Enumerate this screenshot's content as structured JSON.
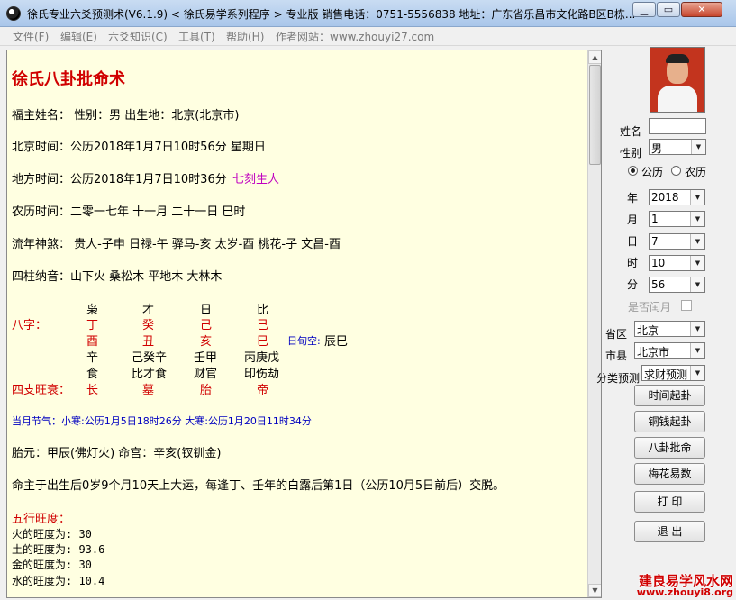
{
  "window": {
    "title": "徐氏专业六爻预测术(V6.1.9)  < 徐氏易学系列程序 > 专业版  销售电话：0751-5556838  地址：广东省乐昌市文化路B区B栋...",
    "min_glyph": "▁",
    "max_glyph": "▭",
    "close_glyph": "✕"
  },
  "menu": {
    "file": "文件(F)",
    "edit": "编辑(E)",
    "knowledge": "六爻知识(C)",
    "tools": "工具(T)",
    "help": "帮助(H)",
    "website": "作者网站：www.zhouyi27.com"
  },
  "document": {
    "heading": "徐氏八卦批命术",
    "owner_line": "福主姓名：  性别：男    出生地：北京(北京市)",
    "beijing_time": "北京时间：公历2018年1月7日10时56分  星期日",
    "local_time_label": "地方时间：公历2018年1月7日10时36分",
    "local_time_note": "七刻生人",
    "lunar_time": "农历时间：二零一七年  十一月  二十一日  巳时",
    "shensha": "流年神煞：  贵人-子申  日禄-午  驿马-亥  太岁-酉  桃花-子  文昌-酉",
    "nayin": "四柱纳音：山下火     桑松木     平地木     大林木",
    "bazi_label": "八字：",
    "shishen_top": [
      "枭",
      "才",
      "日",
      "比"
    ],
    "stems": [
      "丁",
      "癸",
      "己",
      "己"
    ],
    "branches": [
      "酉",
      "丑",
      "亥",
      "巳"
    ],
    "xunkong_label": "日旬空:",
    "xunkong_value": "辰巳",
    "canggan": [
      "辛",
      "己癸辛",
      "壬甲",
      "丙庚戊"
    ],
    "canggan_shishen": [
      "食",
      "比才食",
      "财官",
      "印伤劫"
    ],
    "wangshuai_label": "四支旺衰：",
    "wangshuai": [
      "长",
      "墓",
      "胎",
      "帝"
    ],
    "jieqi": "当月节气：小寒:公历1月5日18时26分  大寒:公历1月20日11时34分",
    "taiyuan": "胎元：甲辰(佛灯火)    命宫：辛亥(钗钏金)",
    "dayun": "命主于出生后0岁9个月10天上大运，每逢丁、壬年的白露后第1日（公历10月5日前后）交脱。",
    "wuxing_title": "五行旺度：",
    "wuxing": [
      "火的旺度为: 30",
      "土的旺度为: 93.6",
      "金的旺度为: 30",
      "水的旺度为: 10.4"
    ]
  },
  "panel": {
    "name_label": "姓名",
    "name_value": "",
    "gender_label": "性别",
    "gender_value": "男",
    "solar_label": "公历",
    "lunar_label": "农历",
    "year_label": "年",
    "year_value": "2018",
    "month_label": "月",
    "month_value": "1",
    "day_label": "日",
    "day_value": "7",
    "hour_label": "时",
    "hour_value": "10",
    "minute_label": "分",
    "minute_value": "56",
    "leap_label": "是否闰月",
    "province_label": "省区",
    "province_value": "北京",
    "city_label": "市县",
    "city_value": "北京市",
    "category_label": "分类预测",
    "category_value": "求财预测",
    "buttons": {
      "time": "时间起卦",
      "coin": "铜钱起卦",
      "bagua": "八卦批命",
      "meihua": "梅花易数",
      "print": "打  印",
      "exit": "退  出"
    }
  },
  "watermark": {
    "line1": "建良易学风水网",
    "line2": "www.zhouyi8.org"
  },
  "colors": {
    "doc_background": "#ffffe1",
    "accent_red": "#d00000",
    "note_magenta": "#c000c0",
    "info_blue": "#0000c0"
  }
}
